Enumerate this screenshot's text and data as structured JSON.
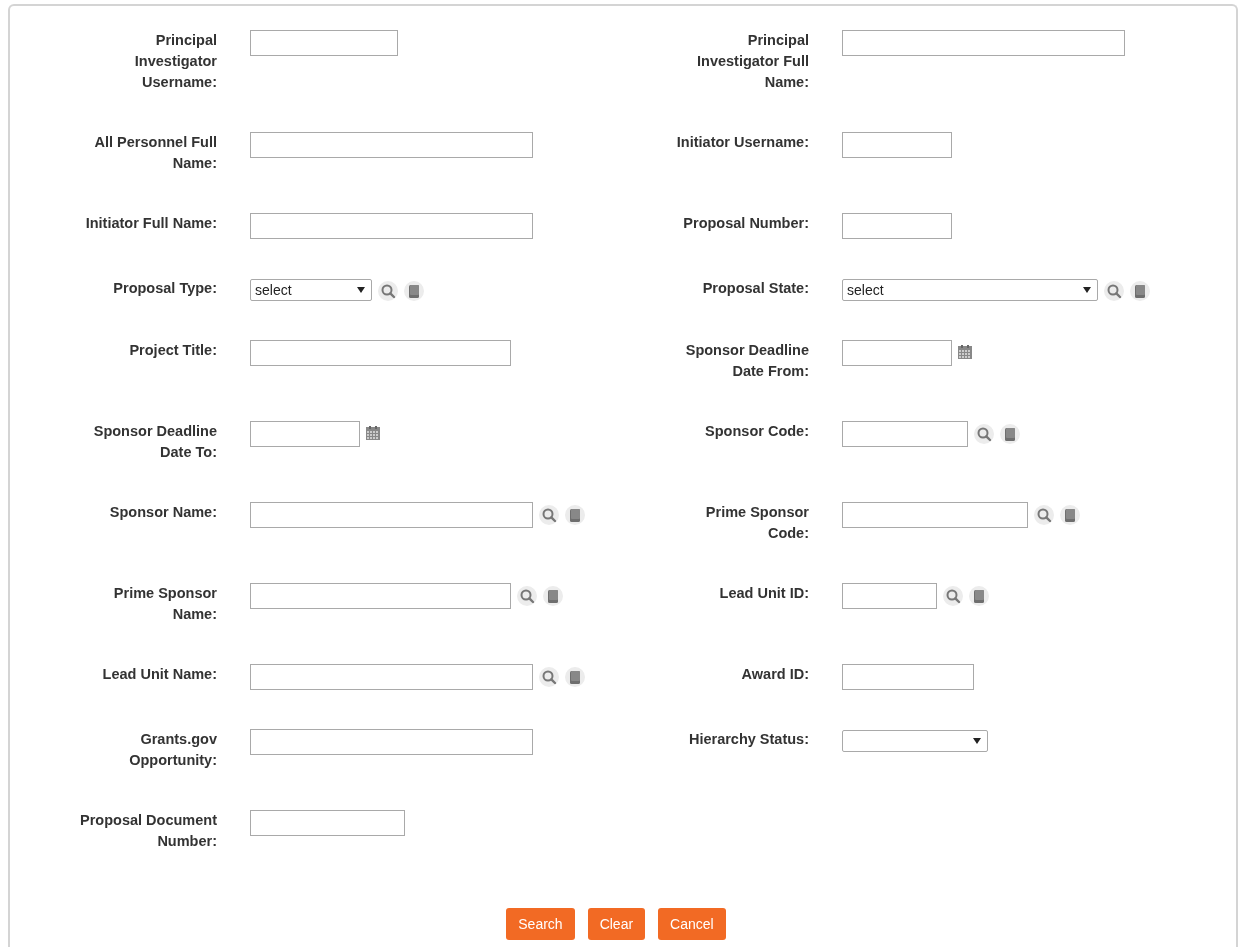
{
  "rows": [
    {
      "left": {
        "label": "Principal Investigator Username:",
        "kind": "text"
      },
      "right": {
        "label": "Principal Investigator Full Name:",
        "kind": "text"
      }
    },
    {
      "left": {
        "label": "All Personnel Full Name:",
        "kind": "text"
      },
      "right": {
        "label": "Initiator Username:",
        "kind": "text"
      }
    },
    {
      "left": {
        "label": "Initiator Full Name:",
        "kind": "text"
      },
      "right": {
        "label": "Proposal Number:",
        "kind": "text"
      }
    },
    {
      "left": {
        "label": "Proposal Type:",
        "kind": "lookup_select",
        "value": "select"
      },
      "right": {
        "label": "Proposal State:",
        "kind": "lookup_select",
        "value": "select"
      }
    },
    {
      "left": {
        "label": "Project Title:",
        "kind": "text"
      },
      "right": {
        "label": "Sponsor Deadline Date From:",
        "kind": "date"
      }
    },
    {
      "left": {
        "label": "Sponsor Deadline Date To:",
        "kind": "date"
      },
      "right": {
        "label": "Sponsor Code:",
        "kind": "lookup_text"
      }
    },
    {
      "left": {
        "label": "Sponsor Name:",
        "kind": "lookup_text"
      },
      "right": {
        "label": "Prime Sponsor Code:",
        "kind": "lookup_text"
      }
    },
    {
      "left": {
        "label": "Prime Sponsor Name:",
        "kind": "lookup_text"
      },
      "right": {
        "label": "Lead Unit ID:",
        "kind": "lookup_text"
      }
    },
    {
      "left": {
        "label": "Lead Unit Name:",
        "kind": "lookup_text"
      },
      "right": {
        "label": "Award ID:",
        "kind": "text"
      }
    },
    {
      "left": {
        "label": "Grants.gov Opportunity:",
        "kind": "text"
      },
      "right": {
        "label": "Hierarchy Status:",
        "kind": "select"
      }
    },
    {
      "left": {
        "label": "Proposal Document Number:",
        "kind": "text"
      }
    }
  ],
  "buttons": [
    "Search",
    "Clear",
    "Cancel"
  ]
}
